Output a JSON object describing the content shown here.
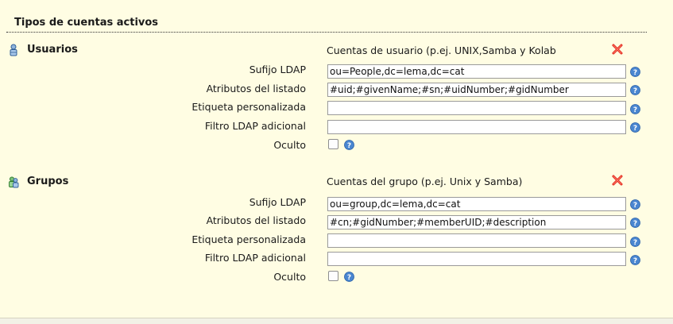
{
  "section": {
    "title": "Tipos de cuentas activos"
  },
  "account_types": [
    {
      "name": "Usuarios",
      "icon": "user-icon",
      "description": "Cuentas de usuario (p.ej. UNIX,Samba y Kolab",
      "fields": {
        "suffix_label": "Sufijo LDAP",
        "suffix_value": "ou=People,dc=lema,dc=cat",
        "attributes_label": "Atributos del listado",
        "attributes_value": "#uid;#givenName;#sn;#uidNumber;#gidNumber",
        "custom_label_label": "Etiqueta personalizada",
        "custom_label_value": "",
        "filter_label": "Filtro LDAP adicional",
        "filter_value": "",
        "hidden_label": "Oculto",
        "hidden_checked": false
      }
    },
    {
      "name": "Grupos",
      "icon": "group-icon",
      "description": "Cuentas del grupo (p.ej. Unix y Samba)",
      "fields": {
        "suffix_label": "Sufijo LDAP",
        "suffix_value": "ou=group,dc=lema,dc=cat",
        "attributes_label": "Atributos del listado",
        "attributes_value": "#cn;#gidNumber;#memberUID;#description",
        "custom_label_label": "Etiqueta personalizada",
        "custom_label_value": "",
        "filter_label": "Filtro LDAP adicional",
        "filter_value": "",
        "hidden_label": "Oculto",
        "hidden_checked": false
      }
    }
  ],
  "colors": {
    "background": "#fffde3",
    "remove": "#e0271b",
    "help": "#3a78c8"
  }
}
